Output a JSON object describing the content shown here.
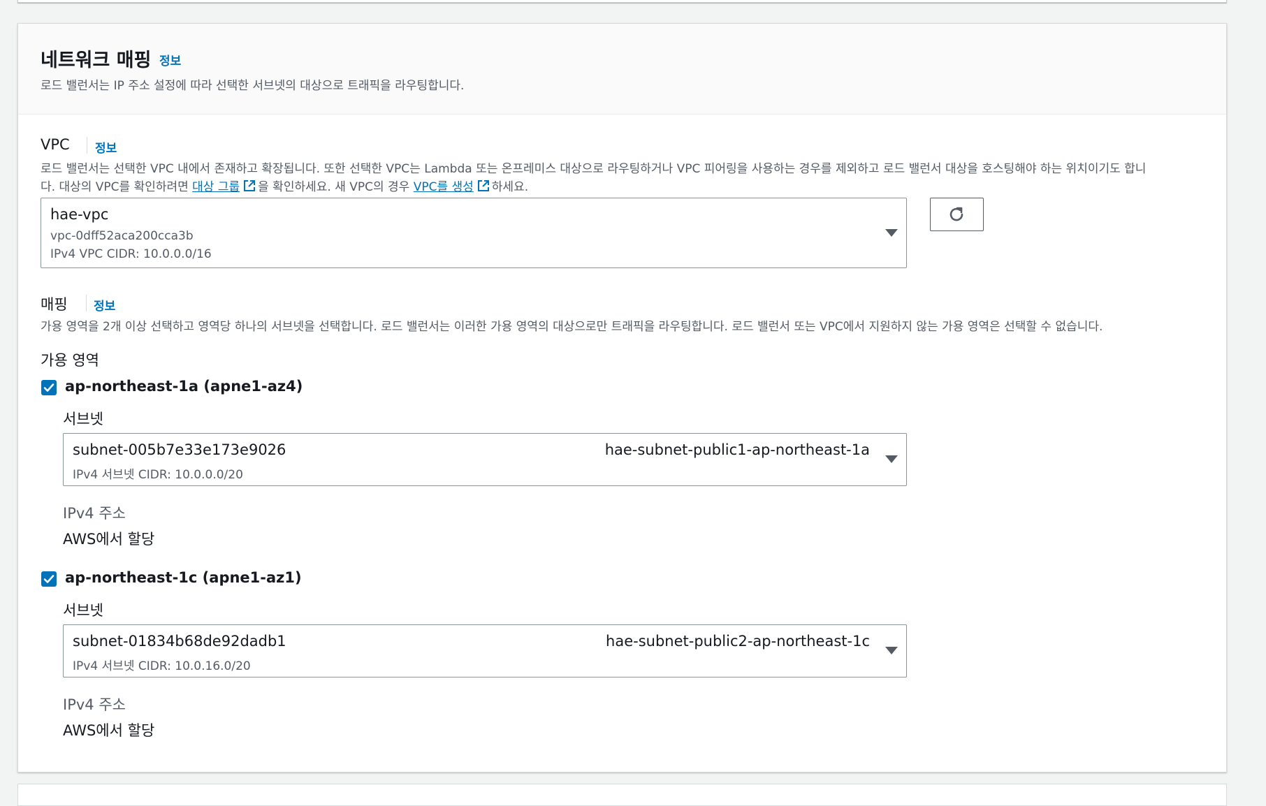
{
  "section": {
    "title": "네트워크 매핑",
    "info_link": "정보",
    "description": "로드 밸런서는 IP 주소 설정에 따라 선택한 서브넷의 대상으로 트래픽을 라우팅합니다."
  },
  "vpc": {
    "label": "VPC",
    "info_link": "정보",
    "description_line1": "로드 밸런서는 선택한 VPC 내에서 존재하고 확장됩니다. 또한 선택한 VPC는 Lambda 또는 온프레미스 대상으로 라우팅하거나 VPC 피어링을 사용하는 경우를 제외하고 로드 밸런서 대상을 호스팅해야 하는 위치이기도 합니",
    "description_line2_pre": "다. 대상의 VPC를 확인하려면 ",
    "target_group_link": "대상 그룹",
    "description_line2_mid": "을 확인하세요. 새 VPC의 경우 ",
    "create_vpc_link": "VPC를 생성",
    "description_line2_post": "하세요.",
    "selected_name": "hae-vpc",
    "selected_id": "vpc-0dff52aca200cca3b",
    "selected_cidr": "IPv4 VPC CIDR: 10.0.0.0/16"
  },
  "mapping": {
    "label": "매핑",
    "info_link": "정보",
    "description": "가용 영역을 2개 이상 선택하고 영역당 하나의 서브넷을 선택합니다. 로드 밸런서는 이러한 가용 영역의 대상으로만 트래픽을 라우팅합니다. 로드 밸런서 또는 VPC에서 지원하지 않는 가용 영역은 선택할 수 없습니다.",
    "az_heading": "가용 영역",
    "zones": [
      {
        "name": "ap-northeast-1a (apne1-az4)",
        "checked": true,
        "subnet_label": "서브넷",
        "subnet_id": "subnet-005b7e33e173e9026",
        "subnet_name": "hae-subnet-public1-ap-northeast-1a",
        "subnet_cidr": "IPv4 서브넷 CIDR: 10.0.0.0/20",
        "ipv4_label": "IPv4 주소",
        "ipv4_value": "AWS에서 할당"
      },
      {
        "name": "ap-northeast-1c (apne1-az1)",
        "checked": true,
        "subnet_label": "서브넷",
        "subnet_id": "subnet-01834b68de92dadb1",
        "subnet_name": "hae-subnet-public2-ap-northeast-1c",
        "subnet_cidr": "IPv4 서브넷 CIDR: 10.0.16.0/20",
        "ipv4_label": "IPv4 주소",
        "ipv4_value": "AWS에서 할당"
      }
    ]
  },
  "icons": {
    "refresh": "refresh-icon",
    "external": "external-link-icon",
    "caret": "caret-down-icon",
    "check": "checkmark-icon"
  },
  "colors": {
    "accent": "#0073bb",
    "text": "#16191f",
    "secondary_text": "#545b64",
    "border": "#879596"
  }
}
